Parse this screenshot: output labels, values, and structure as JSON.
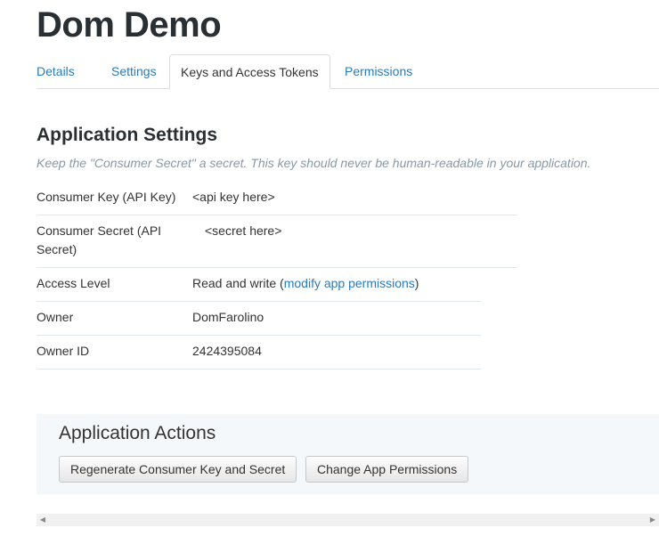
{
  "app": {
    "title": "Dom Demo"
  },
  "tabs": [
    {
      "label": "Details"
    },
    {
      "label": "Settings"
    },
    {
      "label": "Keys and Access Tokens",
      "active": true
    },
    {
      "label": "Permissions"
    }
  ],
  "settings": {
    "title": "Application Settings",
    "hint": "Keep the \"Consumer Secret\" a secret. This key should never be human-readable in your application.",
    "rows": [
      {
        "label": "Consumer Key (API Key)",
        "value": "<api key here>"
      },
      {
        "label": "Consumer Secret (API Secret)",
        "value": "<secret here>"
      },
      {
        "label": "Access Level",
        "value_prefix": "Read and write (",
        "link": "modify app permissions",
        "value_suffix": ")"
      },
      {
        "label": "Owner",
        "value": "DomFarolino"
      },
      {
        "label": "Owner ID",
        "value": "2424395084"
      }
    ]
  },
  "actions": {
    "title": "Application Actions",
    "regenerate_label": "Regenerate Consumer Key and Secret",
    "change_permissions_label": "Change App Permissions"
  },
  "colors": {
    "link": "#2b7bb9",
    "title": "#292f33",
    "hint": "#8899a6",
    "panel": "#f5f8fa"
  }
}
